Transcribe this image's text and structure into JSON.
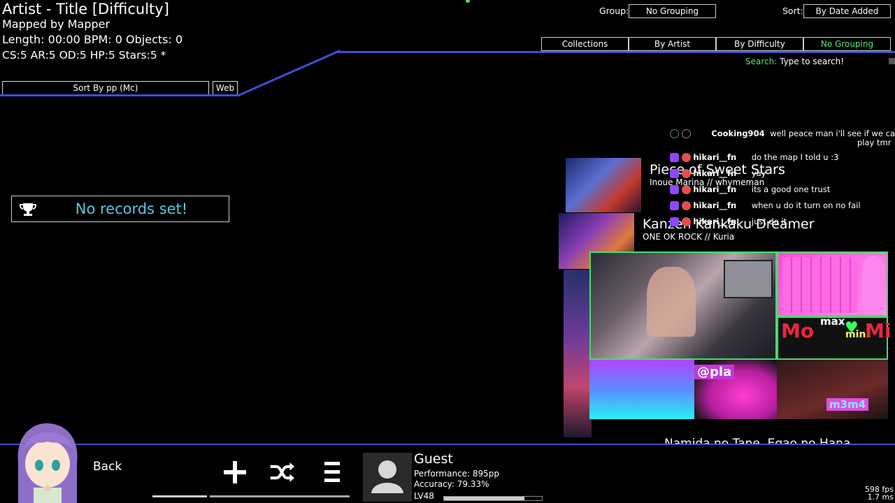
{
  "beatmap": {
    "title": "Artist - Title [Difficulty]",
    "mapper": "Mapped by Mapper",
    "length_line": "Length: 00:00 BPM: 0 Objects: 0",
    "stats_line": "CS:5 AR:5 OD:5 HP:5 Stars:5 *"
  },
  "controls": {
    "sort_pp": "Sort By pp (Mc)",
    "web": "Web",
    "group_label": "Group:",
    "group_value": "No Grouping",
    "sort_label": "Sort:",
    "sort_value": "By Date Added",
    "tabs": [
      "Collections",
      "By Artist",
      "By Difficulty",
      "No Grouping"
    ],
    "active_tab": "No Grouping",
    "search_key": "Search:",
    "search_text": "Type to search!"
  },
  "records": {
    "text": "No records set!"
  },
  "songs": [
    {
      "name": "Piece of Sweet Stars",
      "sub": "Inoue Marina // whymeman"
    },
    {
      "name": "Kanzen Kankaku Dreamer",
      "sub": "ONE OK ROCK // Kuria"
    },
    {
      "name": "Namida no Tane, Egao no Hana",
      "sub": ""
    }
  ],
  "chat": [
    {
      "user": "Cooking904",
      "msg": "well peace man i'll see if we can",
      "msg2": "play tmr"
    },
    {
      "user": "hikari__fn",
      "msg": "do the map I told u :3"
    },
    {
      "user": "hikari__fn",
      "msg": "yay"
    },
    {
      "user": "hikari__fn",
      "msg": "its a good one trust"
    },
    {
      "user": "hikari__fn",
      "msg": "when u do it turn on no fail"
    },
    {
      "user": "hikari__fn",
      "msg": "just do it"
    }
  ],
  "overlay": {
    "mm_left": "Mo",
    "mm_max": "max",
    "mm_min": "min",
    "mm_right": "Mi",
    "pla": "@pla",
    "m3m4": "m3m4"
  },
  "bottom": {
    "back": "Back",
    "user": "Guest",
    "performance": "Performance: 895pp",
    "accuracy": "Accuracy: 79.33%",
    "level": "LV48",
    "level_progress": 0.82,
    "fps": "598 fps",
    "ms": "1.7 ms"
  },
  "colors": {
    "accent_blue": "#3b4fd6",
    "green": "#5de66a",
    "records_text": "#59c6e0"
  }
}
